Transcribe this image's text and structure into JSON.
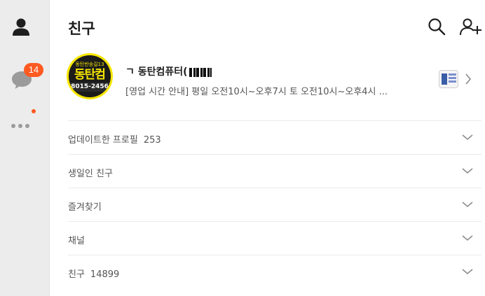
{
  "sidebar": {
    "chats_badge": "14"
  },
  "header": {
    "title": "친구"
  },
  "profile": {
    "avatar": {
      "top_text": "동탄반송길13",
      "name_text": "동탄컴",
      "phone_text": "8015-2456"
    },
    "name": "ㄱ 동탄컴퓨터(",
    "status": "[영업 시간 안내] 평일 오전10시~오후7시 토 오전10시~오후4시 ..."
  },
  "sections": [
    {
      "label": "업데이트한 프로필",
      "count": "253"
    },
    {
      "label": "생일인 친구",
      "count": ""
    },
    {
      "label": "즐겨찾기",
      "count": ""
    },
    {
      "label": "채널",
      "count": ""
    },
    {
      "label": "친구",
      "count": "14899"
    }
  ],
  "icons": {
    "rail": [
      "person-icon",
      "chat-bubble-icon",
      "more-dots-icon"
    ],
    "header": [
      "search-icon",
      "add-friend-icon"
    ],
    "section": "chevron-down-icon"
  },
  "colors": {
    "rail_bg": "#ececec",
    "badge": "#ff5a22",
    "avatar_yellow": "#f7e600"
  }
}
